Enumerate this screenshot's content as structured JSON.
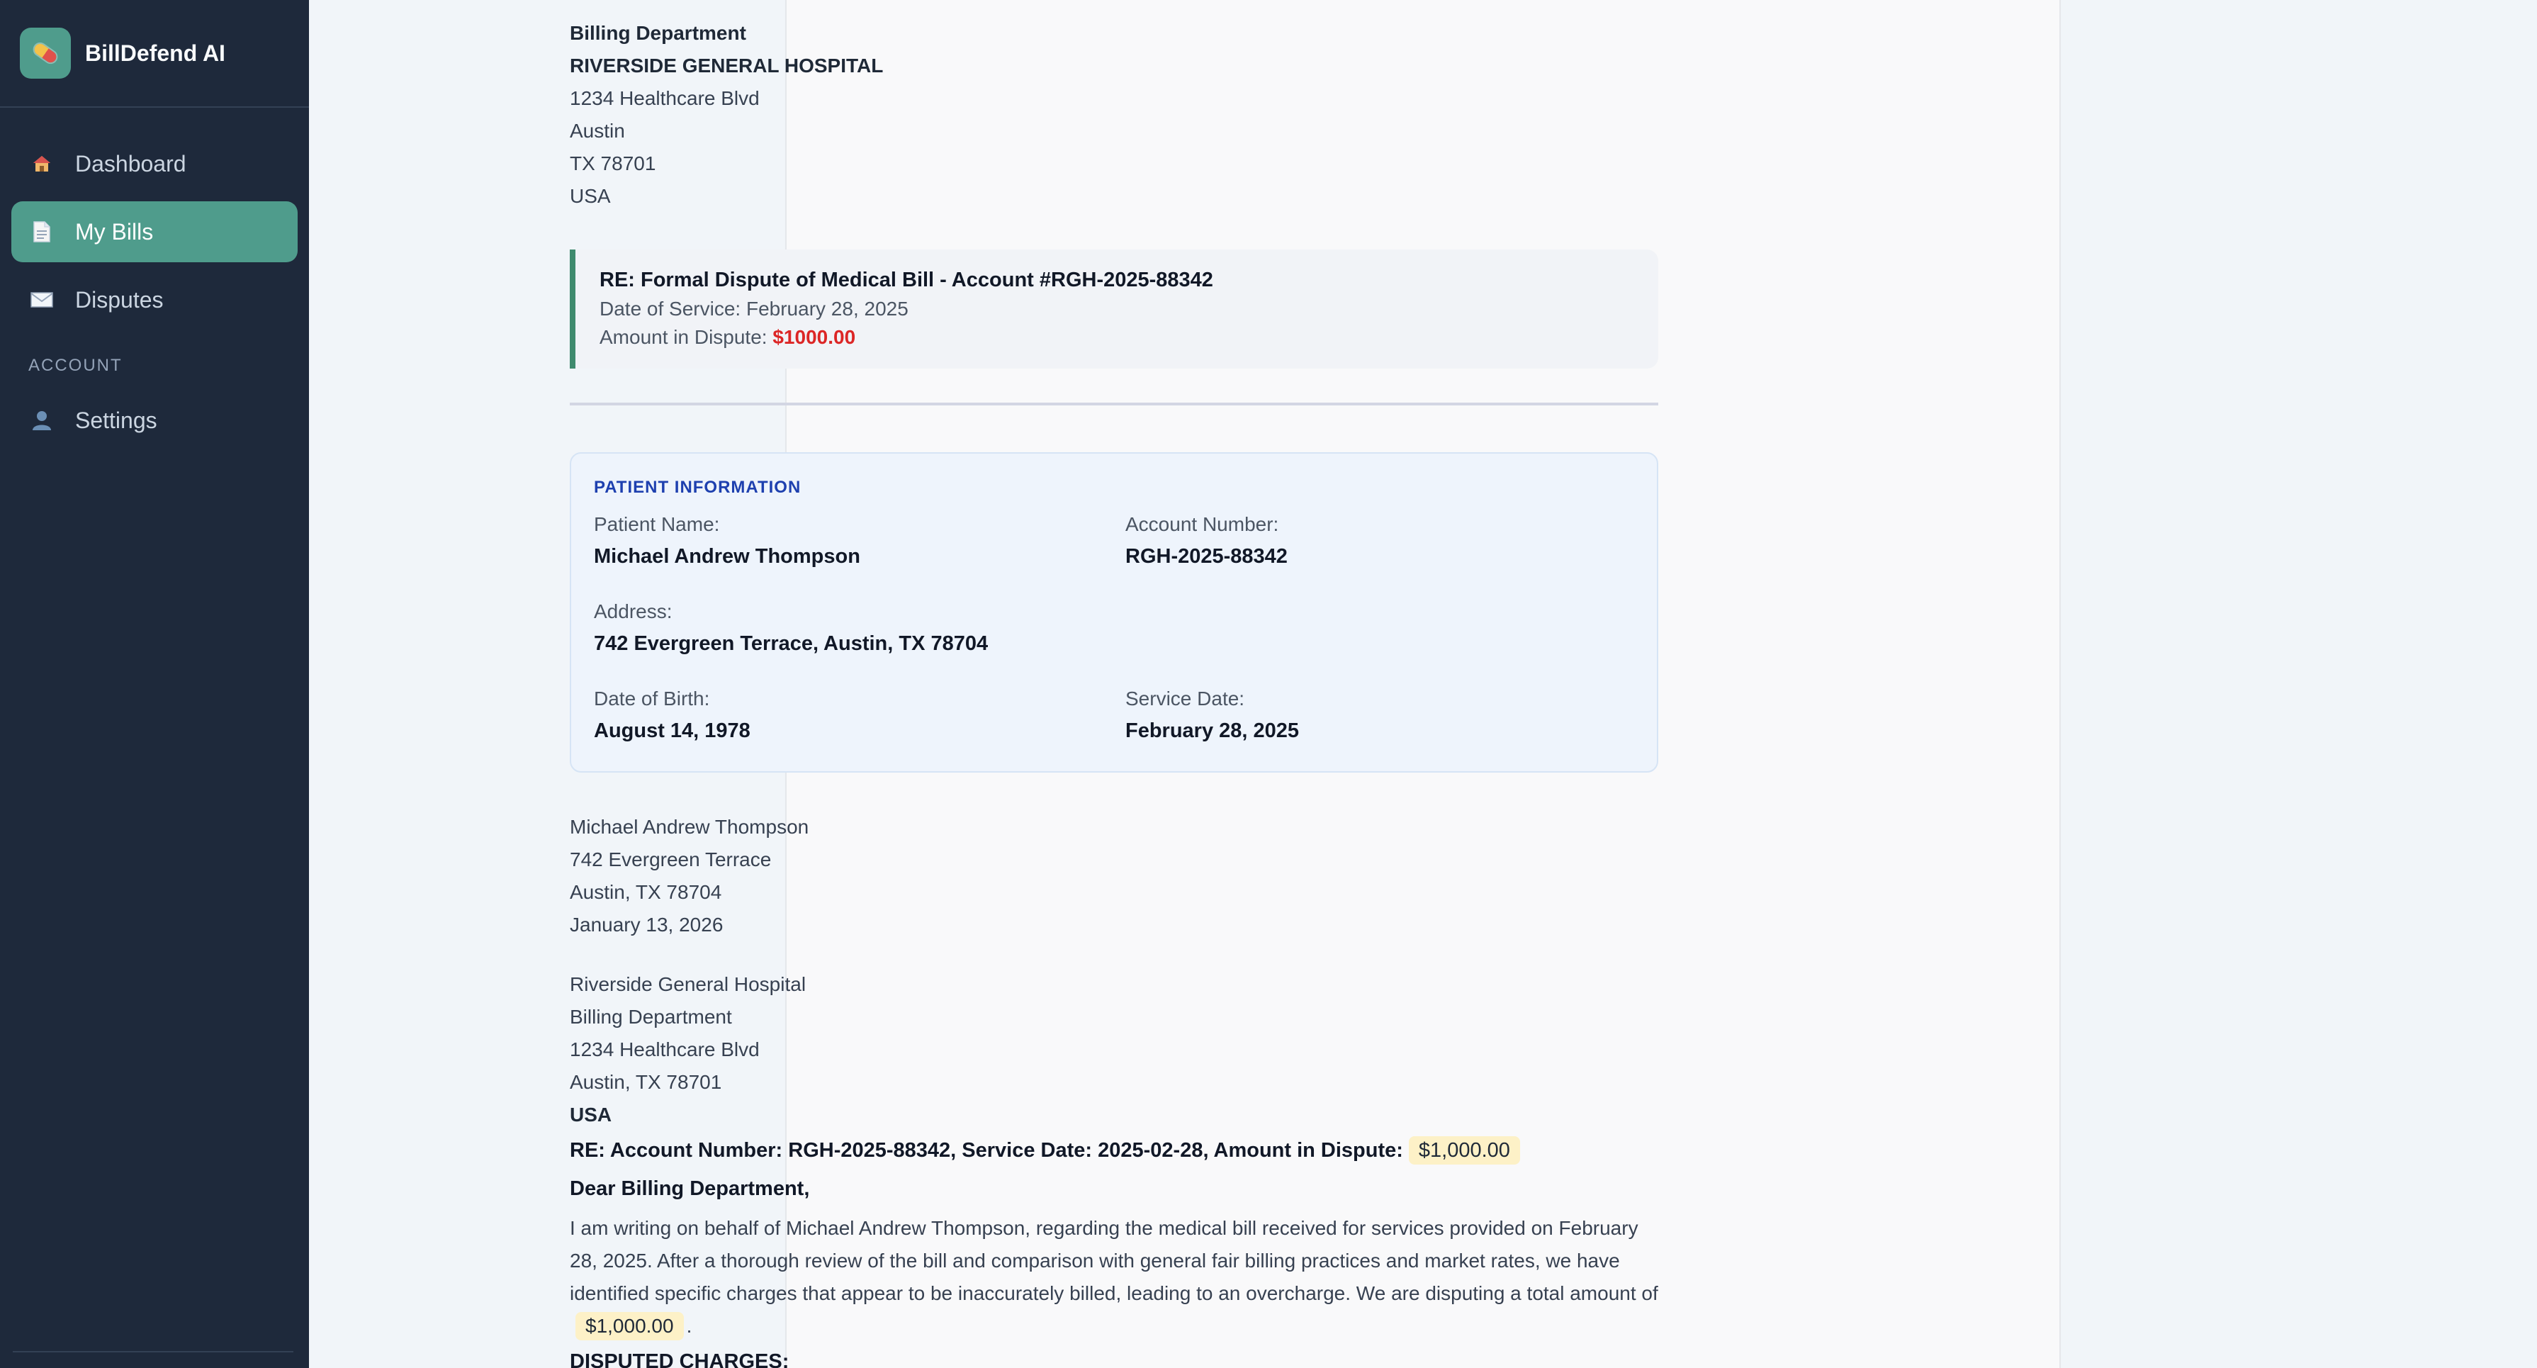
{
  "app": {
    "name": "BillDefend AI"
  },
  "sidebar": {
    "items": [
      {
        "label": "Dashboard",
        "icon": "house-icon"
      },
      {
        "label": "My Bills",
        "icon": "document-icon",
        "active": true
      },
      {
        "label": "Disputes",
        "icon": "envelope-icon"
      }
    ],
    "section_label": "ACCOUNT",
    "account_items": [
      {
        "label": "Settings",
        "icon": "user-icon"
      }
    ]
  },
  "letter": {
    "recipient": {
      "dept": "Billing Department",
      "org": "RIVERSIDE GENERAL HOSPITAL",
      "street": "1234 Healthcare Blvd",
      "city": "Austin",
      "state_zip": "TX 78701",
      "country": "USA"
    },
    "re_box": {
      "title": "RE: Formal Dispute of Medical Bill - Account #RGH-2025-88342",
      "service_label": "Date of Service:",
      "service_date": "February 28, 2025",
      "amount_label": "Amount in Dispute:",
      "amount": "$1000.00"
    },
    "patient_info": {
      "heading": "PATIENT INFORMATION",
      "name_label": "Patient Name:",
      "name": "Michael Andrew Thompson",
      "account_label": "Account Number:",
      "account": "RGH-2025-88342",
      "address_label": "Address:",
      "address": "742 Evergreen Terrace, Austin, TX 78704",
      "dob_label": "Date of Birth:",
      "dob": "August 14, 1978",
      "service_label": "Service Date:",
      "service_date": "February 28, 2025"
    },
    "sender": {
      "name": "Michael Andrew Thompson",
      "street": "742 Evergreen Terrace",
      "city": "Austin, TX 78704",
      "date": "January 13, 2026"
    },
    "recipient2": {
      "org": "Riverside General Hospital",
      "dept": "Billing Department",
      "street": "1234 Healthcare Blvd",
      "city": "Austin, TX 78701",
      "country": "USA"
    },
    "subject_line": "RE: Account Number: RGH-2025-88342, Service Date: 2025-02-28, Amount in Dispute:",
    "subject_amount": "$1,000.00",
    "salutation": "Dear Billing Department,",
    "body_text": "I am writing on behalf of Michael Andrew Thompson, regarding the medical bill received for services provided on February 28, 2025. After a thorough review of the bill and comparison with general fair billing practices and market rates, we have identified specific charges that appear to be inaccurately billed, leading to an overcharge. We are disputing a total amount of",
    "body_amount": "$1,000.00",
    "body_end": ".",
    "disputed_heading": "DISPUTED CHARGES:"
  }
}
